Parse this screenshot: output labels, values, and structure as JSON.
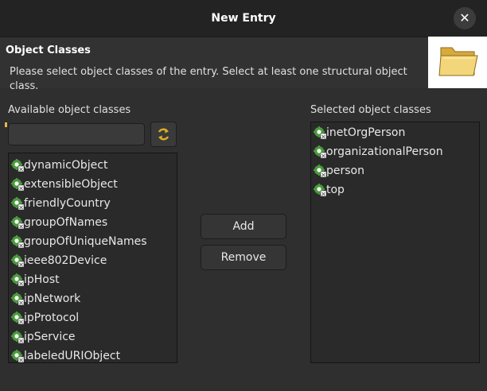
{
  "window": {
    "title": "New Entry"
  },
  "header": {
    "section_title": "Object Classes",
    "description": "Please select object classes of the entry. Select at least one structural object class."
  },
  "available": {
    "label": "Available object classes",
    "filter_value": "",
    "items": [
      "dynamicObject",
      "extensibleObject",
      "friendlyCountry",
      "groupOfNames",
      "groupOfUniqueNames",
      "ieee802Device",
      "ipHost",
      "ipNetwork",
      "ipProtocol",
      "ipService",
      "labeledURIObject"
    ]
  },
  "actions": {
    "add_label": "Add",
    "remove_label": "Remove"
  },
  "selected": {
    "label": "Selected object classes",
    "items": [
      "inetOrgPerson",
      "organizationalPerson",
      "person",
      "top"
    ]
  },
  "icons": {
    "close": "close-icon",
    "wizard": "folder-icon",
    "reload": "refresh-icon",
    "object_class": "object-class-icon"
  },
  "colors": {
    "icon_green": "#4a9a3c",
    "reload_yellow": "#e0b020",
    "folder_yellow": "#f4d67a"
  }
}
